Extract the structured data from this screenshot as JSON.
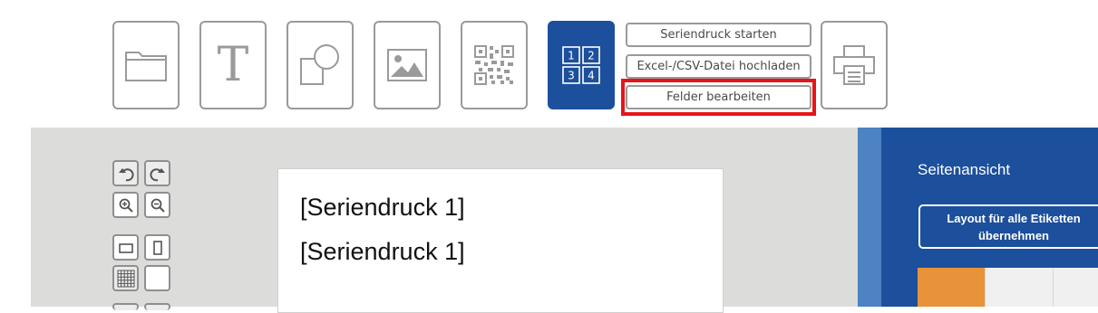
{
  "toolbar": {
    "tools": [
      {
        "name": "folder",
        "icon": "folder-icon"
      },
      {
        "name": "text",
        "icon": "text-T-icon",
        "glyph": "T"
      },
      {
        "name": "shapes",
        "icon": "shapes-icon"
      },
      {
        "name": "image",
        "icon": "image-icon"
      },
      {
        "name": "qr-code",
        "icon": "qr-code-icon"
      },
      {
        "name": "serial-print",
        "icon": "serial-numbers-icon",
        "numbers": [
          "1",
          "2",
          "3",
          "4"
        ],
        "active": true
      },
      {
        "name": "print",
        "icon": "printer-icon"
      }
    ],
    "serial_buttons": {
      "start": "Seriendruck starten",
      "upload": "Excel-/CSV-Datei hochladen",
      "edit_fields": "Felder bearbeiten"
    }
  },
  "side_tools": [
    {
      "icon": "undo-icon"
    },
    {
      "icon": "redo-icon"
    },
    {
      "icon": "zoom-in-icon"
    },
    {
      "icon": "zoom-out-icon"
    },
    {
      "icon": "landscape-icon"
    },
    {
      "icon": "portrait-icon"
    },
    {
      "icon": "grid-icon"
    },
    {
      "icon": "blank-icon"
    }
  ],
  "canvas": {
    "lines": [
      "[Seriendruck 1]",
      "[Seriendruck 1]"
    ]
  },
  "panel": {
    "title": "Seitenansicht",
    "apply_layout_line1": "Layout für alle Etiketten",
    "apply_layout_line2": "übernehmen"
  },
  "colors": {
    "accent": "#1c4f9c",
    "highlight": "#e8141a",
    "workspace": "#dcdcda",
    "label_orange": "#e8923a"
  }
}
